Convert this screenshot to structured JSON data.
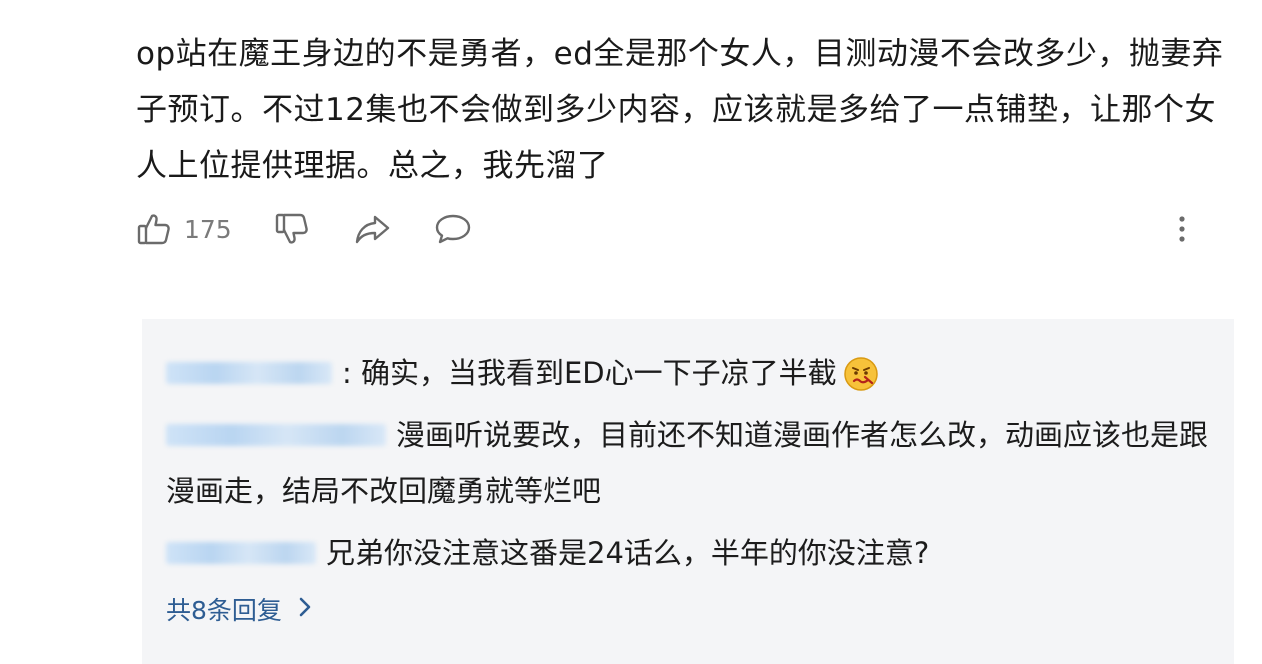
{
  "post": {
    "text": "op站在魔王身边的不是勇者，ed全是那个女人，目测动漫不会改多少，抛妻弃子预订。不过12集也不会做到多少内容，应该就是多给了一点铺垫，让那个女人上位提供理据。总之，我先溜了"
  },
  "actions": {
    "like_count": "175",
    "icons": [
      "thumbs-up-icon",
      "thumbs-down-icon",
      "share-icon",
      "comment-icon",
      "more-vertical-icon"
    ]
  },
  "replies": [
    {
      "text": ": 确实，当我看到ED心一下子凉了半截"
    },
    {
      "text": "漫画听说要改，目前还不知道漫画作者怎么改，动画应该也是跟漫画走，结局不改回魔勇就等烂吧"
    },
    {
      "text": "兄弟你没注意这番是24话么，半年的你没注意?"
    }
  ],
  "more_replies": {
    "label": "共8条回复"
  },
  "colors": {
    "reply_background": "#f4f5f7",
    "link": "#2e5d93",
    "icon": "#6b6b6b"
  }
}
